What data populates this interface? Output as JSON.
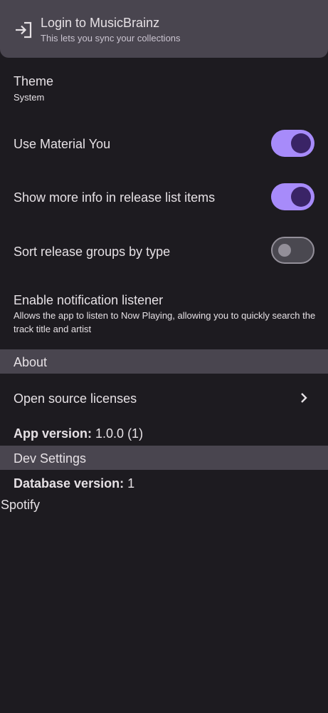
{
  "login": {
    "title": "Login to MusicBrainz",
    "subtitle": "This lets you sync your collections",
    "icon": "login-icon"
  },
  "settings": {
    "theme": {
      "title": "Theme",
      "value": "System"
    },
    "material_you": {
      "title": "Use Material You",
      "enabled": true
    },
    "more_info": {
      "title": "Show more info in release list items",
      "enabled": true
    },
    "sort_by_type": {
      "title": "Sort release groups by type",
      "enabled": false
    },
    "notification_listener": {
      "title": "Enable notification listener",
      "description": "Allows the app to listen to Now Playing, allowing you to quickly search the track title and artist"
    }
  },
  "about": {
    "header": "About",
    "open_source": "Open source licenses",
    "app_version_label": "App version:",
    "app_version_value": "1.0.0 (1)"
  },
  "dev": {
    "header": "Dev Settings",
    "database_version_label": "Database version:",
    "database_version_value": "1",
    "spotify": "Spotify"
  },
  "colors": {
    "background": "#1d1b20",
    "surface": "#49454f",
    "accent": "#a78bfa"
  }
}
